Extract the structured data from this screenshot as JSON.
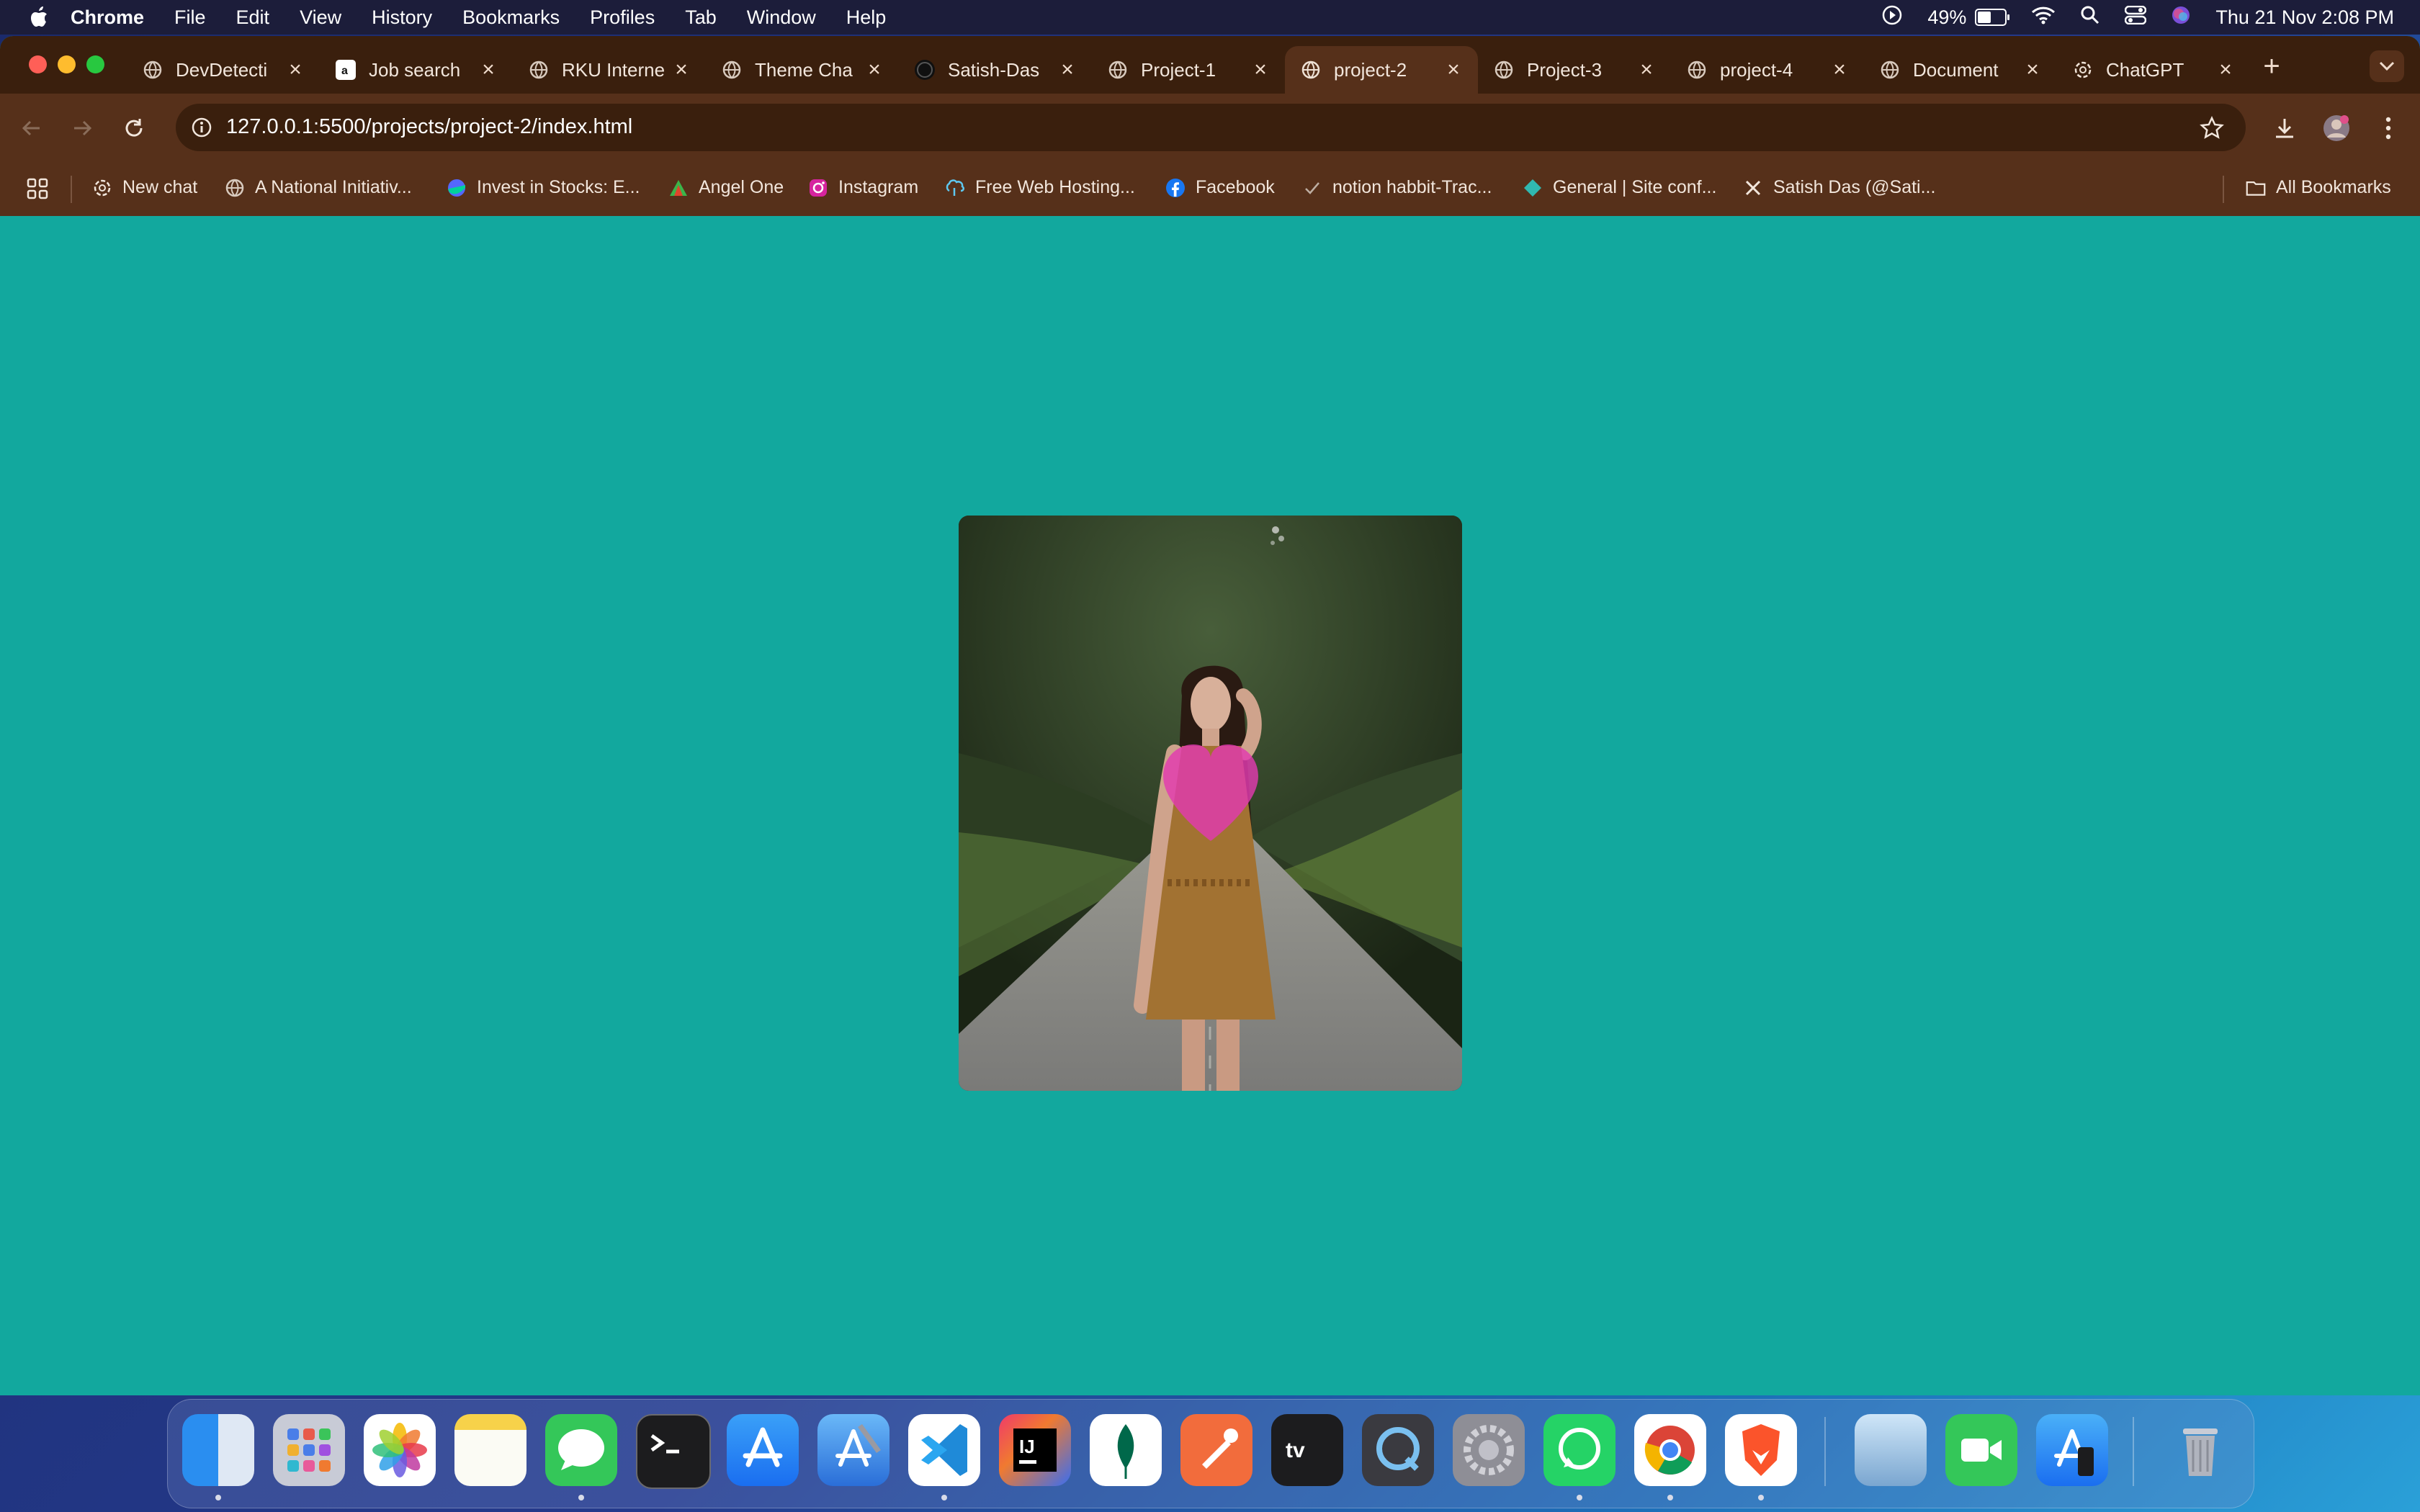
{
  "menubar": {
    "app_name": "Chrome",
    "items": [
      "File",
      "Edit",
      "View",
      "History",
      "Bookmarks",
      "Profiles",
      "Tab",
      "Window",
      "Help"
    ],
    "battery_percent": "49%",
    "battery_level": 0.49,
    "datetime": "Thu 21 Nov  2:08 PM"
  },
  "tabs": [
    {
      "title": "DevDetecti",
      "favicon": "globe-icon",
      "active": false
    },
    {
      "title": "Job search",
      "favicon": "amazon-icon",
      "active": false
    },
    {
      "title": "RKU Interne",
      "favicon": "globe-icon",
      "active": false
    },
    {
      "title": "Theme Cha",
      "favicon": "globe-icon",
      "active": false
    },
    {
      "title": "Satish-Das",
      "favicon": "github-icon",
      "active": false
    },
    {
      "title": "Project-1",
      "favicon": "globe-icon",
      "active": false
    },
    {
      "title": "project-2",
      "favicon": "globe-icon",
      "active": true
    },
    {
      "title": "Project-3",
      "favicon": "globe-icon",
      "active": false
    },
    {
      "title": "project-4",
      "favicon": "globe-icon",
      "active": false
    },
    {
      "title": "Document",
      "favicon": "globe-icon",
      "active": false
    },
    {
      "title": "ChatGPT",
      "favicon": "openai-icon",
      "active": false
    }
  ],
  "address_bar": {
    "url": "127.0.0.1:5500/projects/project-2/index.html"
  },
  "bookmarks": [
    {
      "label": "New chat",
      "icon": "openai-icon"
    },
    {
      "label": "A National Initiativ...",
      "icon": "globe-icon"
    },
    {
      "label": "Invest in Stocks: E...",
      "icon": "groww-icon"
    },
    {
      "label": "Angel One",
      "icon": "angelone-icon"
    },
    {
      "label": "Instagram",
      "icon": "instagram-icon"
    },
    {
      "label": "Free Web Hosting...",
      "icon": "hosting-icon"
    },
    {
      "label": "Facebook",
      "icon": "facebook-icon"
    },
    {
      "label": "notion habbit-Trac...",
      "icon": "check-icon"
    },
    {
      "label": "General | Site conf...",
      "icon": "netlify-icon"
    },
    {
      "label": "Satish Das (@Sati...",
      "icon": "x-icon"
    }
  ],
  "all_bookmarks_label": "All Bookmarks",
  "colors": {
    "page_background": "#12a89e",
    "heart": "#e23ab0",
    "browser_frame": "#56301a",
    "tabstrip": "#3a1f0d"
  },
  "dock": {
    "apps": [
      "finder-icon",
      "launchpad-icon",
      "photos-icon",
      "notes-icon",
      "messages-icon",
      "terminal-icon",
      "app-store-icon",
      "xcode-icon",
      "vscode-icon",
      "intellij-icon",
      "mongodb-compass-icon",
      "postman-icon",
      "apple-tv-icon",
      "quicktime-icon",
      "system-settings-icon",
      "whatsapp-icon",
      "chrome-icon",
      "brave-icon",
      "preview-icon",
      "facetime-icon",
      "simulator-icon",
      "trash-icon"
    ]
  }
}
